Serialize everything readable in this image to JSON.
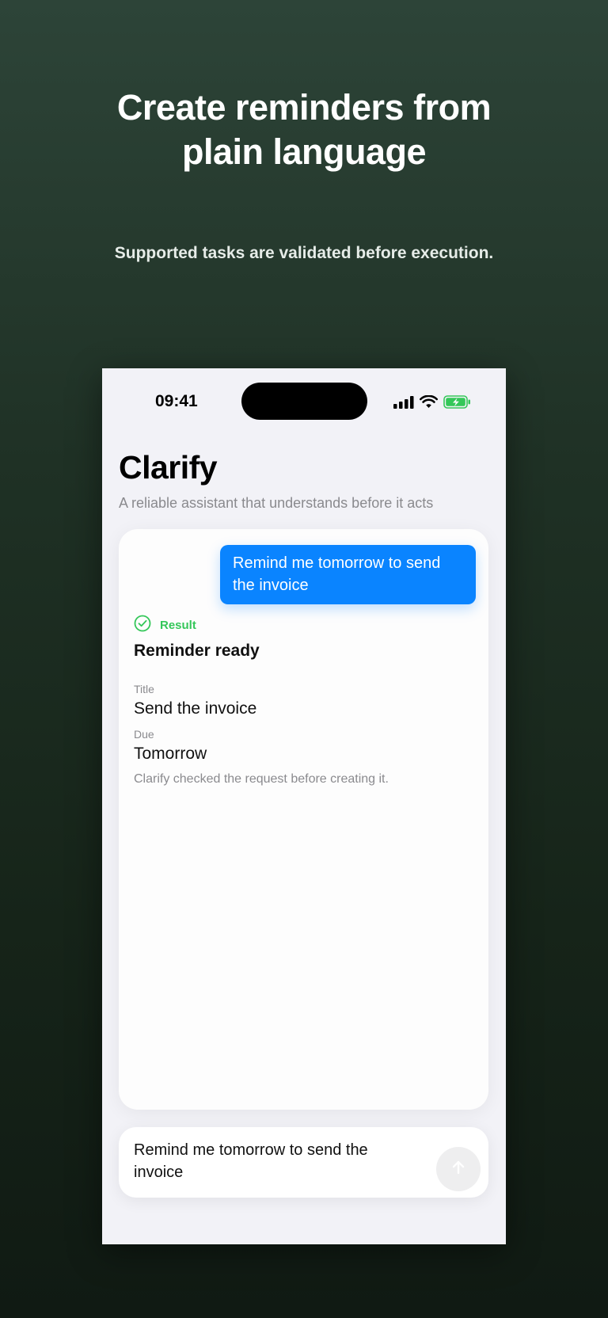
{
  "hero": {
    "title_line1": "Create reminders from",
    "title_line2": "plain language",
    "subtitle": "Supported tasks are validated before execution."
  },
  "status_bar": {
    "time": "09:41"
  },
  "app": {
    "title": "Clarify",
    "subtitle": "A reliable assistant that understands before it acts"
  },
  "chat": {
    "user_message": "Remind me tomorrow to send the invoice",
    "result": {
      "label": "Result",
      "heading": "Reminder ready",
      "fields": [
        {
          "label": "Title",
          "value": "Send the invoice"
        },
        {
          "label": "Due",
          "value": "Tomorrow"
        }
      ],
      "footnote": "Clarify checked the request before creating it."
    }
  },
  "composer": {
    "text": "Remind me tomorrow to send the invoice"
  },
  "colors": {
    "accent_blue": "#0a84ff",
    "success_green": "#34c759",
    "background_dark_green": "#1f3125"
  },
  "icons": {
    "result": "checkmark-circle-icon",
    "send": "arrow-up-icon",
    "signal": "cellular-signal-icon",
    "wifi": "wifi-icon",
    "battery": "battery-charging-icon"
  }
}
